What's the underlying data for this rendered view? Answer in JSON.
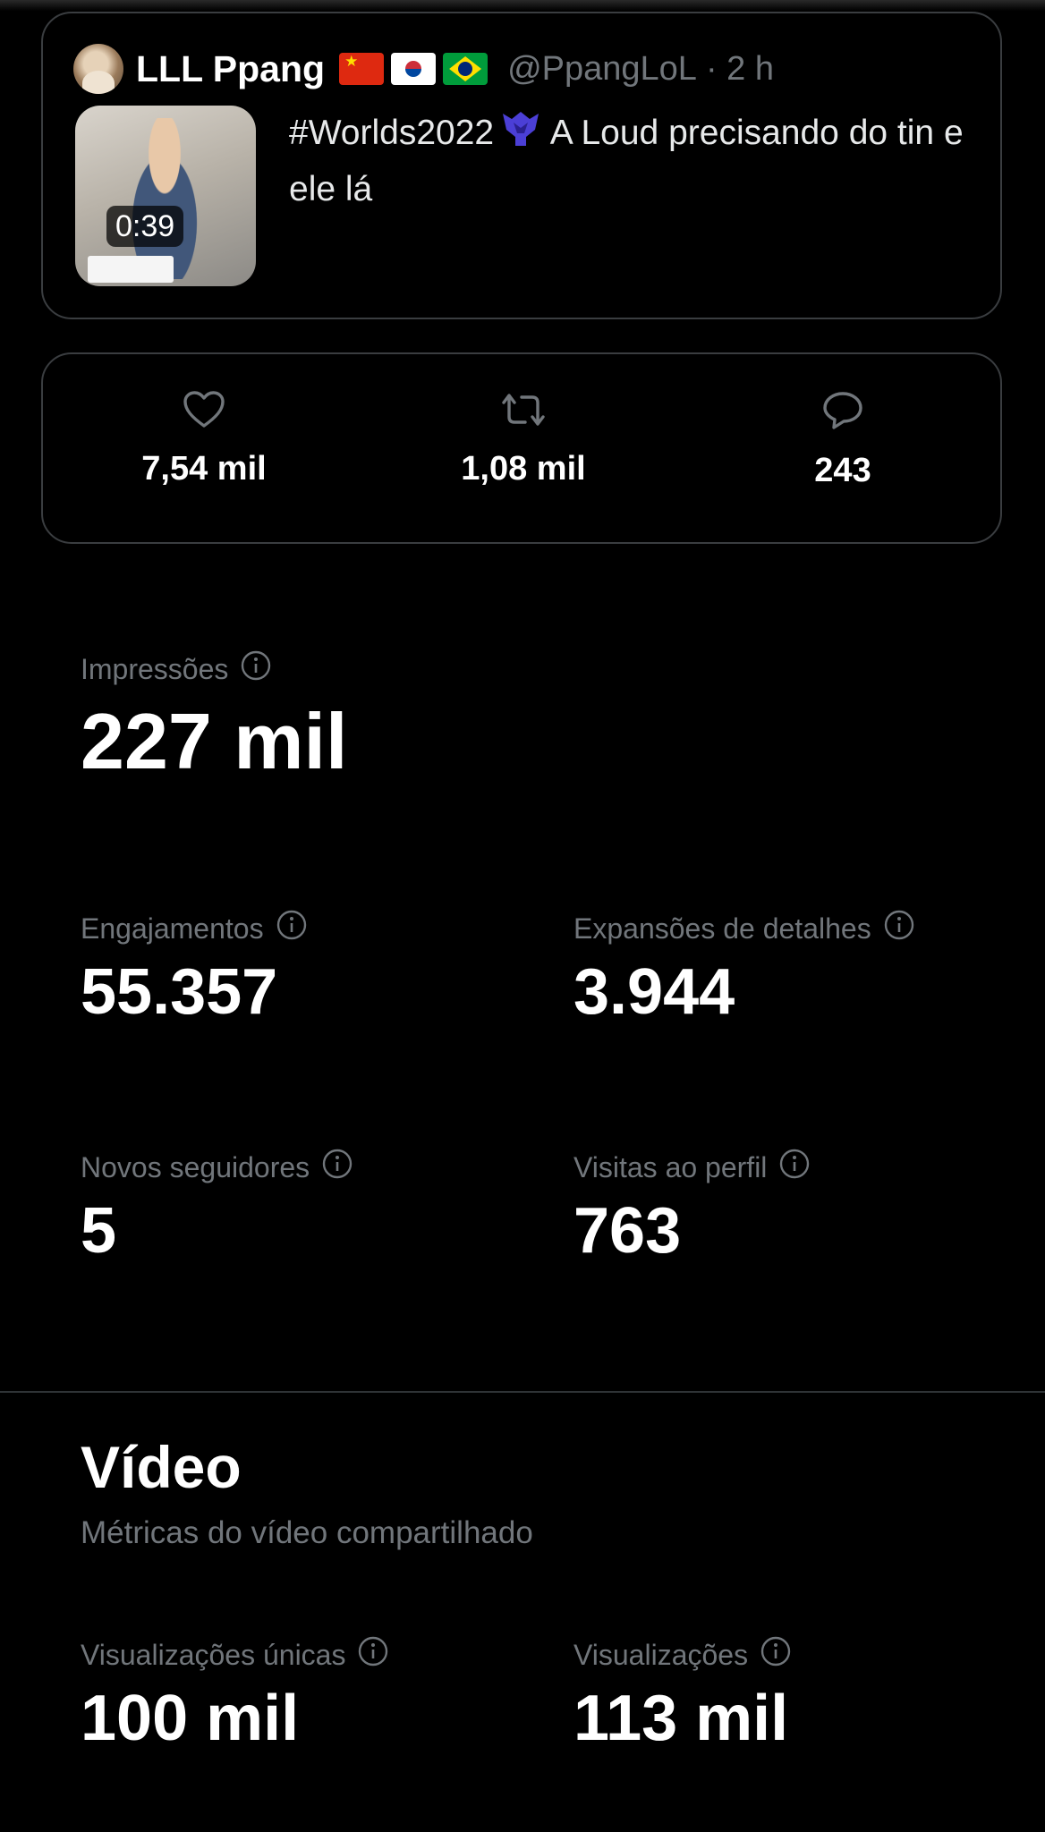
{
  "tweet": {
    "display_name": "LLL Ppang",
    "flags": [
      "china-flag",
      "south-korea-flag",
      "brazil-flag"
    ],
    "handle": "@PpangLoL",
    "time": "· 2 h",
    "text": "#Worlds2022",
    "text_rest": "A Loud precisando do tin e ele lá",
    "video_duration": "0:39"
  },
  "engagement": {
    "likes": "7,54 mil",
    "retweets": "1,08 mil",
    "replies": "243"
  },
  "metrics": {
    "impressions": {
      "label": "Impressões",
      "value": "227 mil"
    },
    "engagements": {
      "label": "Engajamentos",
      "value": "55.357"
    },
    "detail_expands": {
      "label": "Expansões de detalhes",
      "value": "3.944"
    },
    "new_followers": {
      "label": "Novos seguidores",
      "value": "5"
    },
    "profile_visits": {
      "label": "Visitas ao perfil",
      "value": "763"
    }
  },
  "video": {
    "title": "Vídeo",
    "subtitle": "Métricas do vídeo compartilhado",
    "unique_views": {
      "label": "Visualizações únicas",
      "value": "100 mil"
    },
    "views": {
      "label": "Visualizações",
      "value": "113 mil"
    }
  },
  "colors": {
    "background": "#000000",
    "text_primary": "#ffffff",
    "text_secondary": "#71767b",
    "border": "#3a3d40",
    "worlds_icon": "#4b3fd6"
  }
}
